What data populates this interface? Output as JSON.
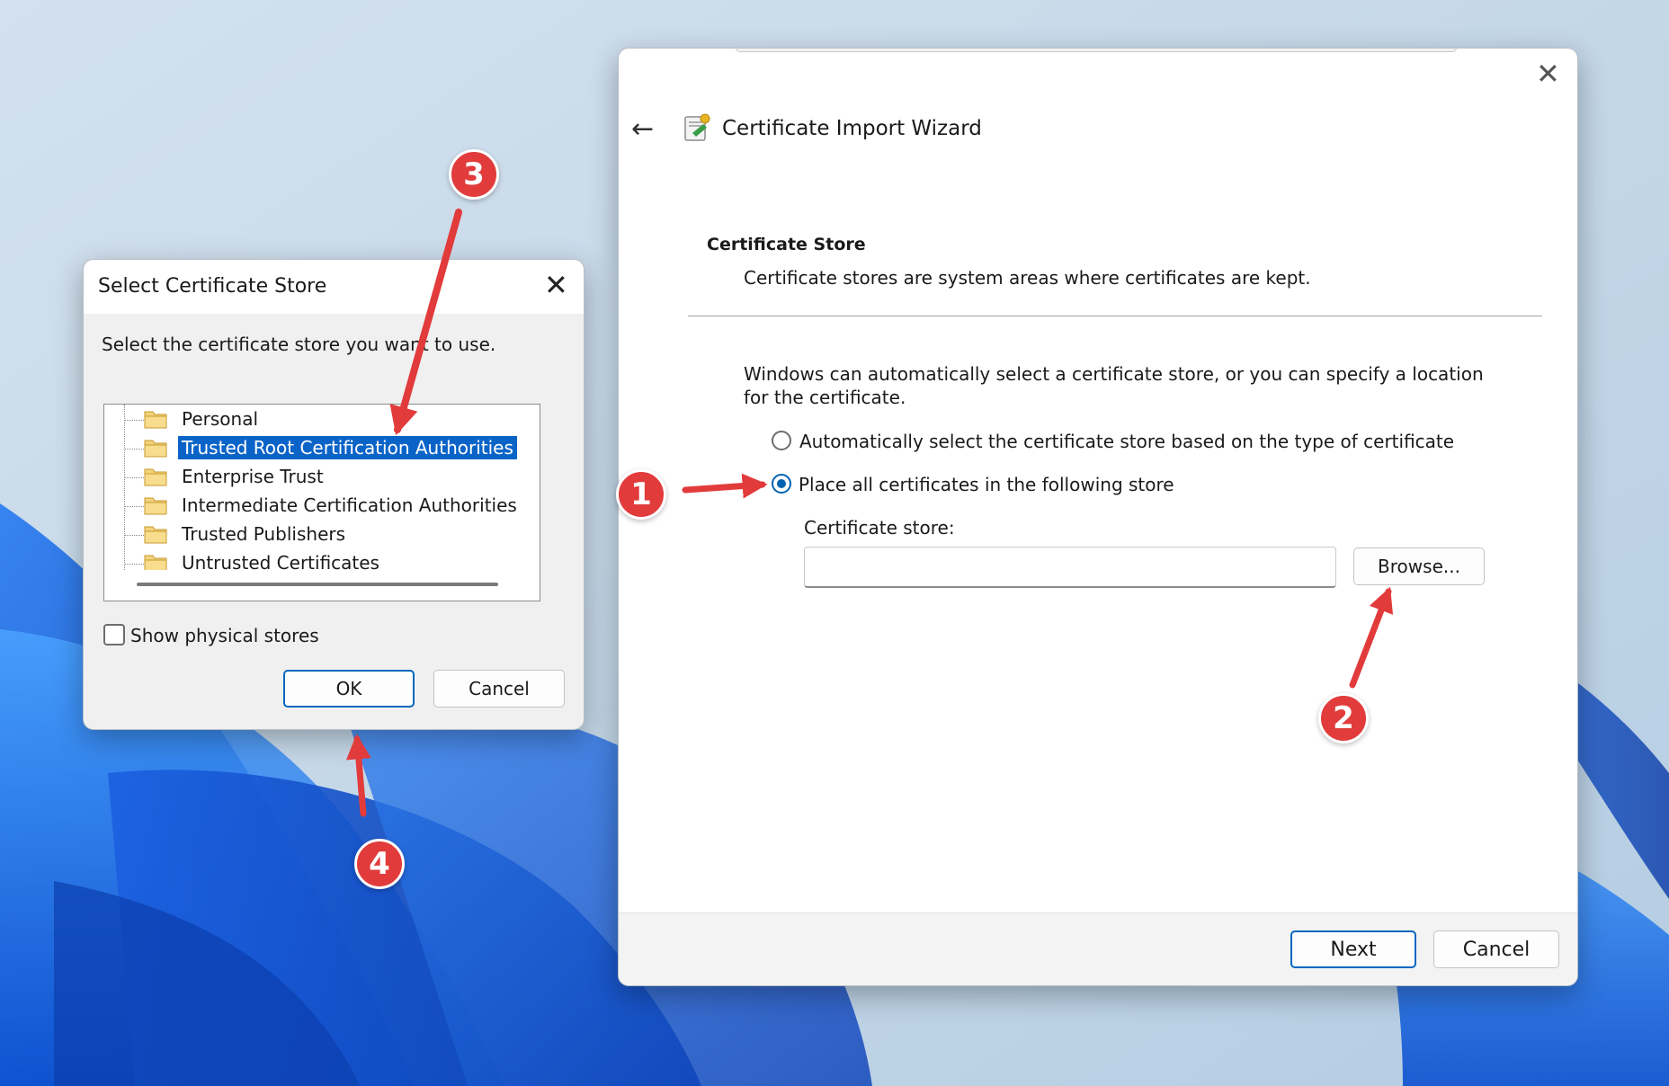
{
  "wizard": {
    "title": "Certificate Import Wizard",
    "close_glyph": "✕",
    "back_glyph": "←",
    "section_title": "Certificate Store",
    "section_subtitle": "Certificate stores are system areas where certificates are kept.",
    "description": "Windows can automatically select a certificate store, or you can specify a location for the certificate.",
    "radio_auto_label": "Automatically select the certificate store based on the type of certificate",
    "radio_manual_label": "Place all certificates in the following store",
    "store_field_label": "Certificate store:",
    "store_field_value": "",
    "browse_label": "Browse...",
    "next_label": "Next",
    "cancel_label": "Cancel",
    "selected_option": "manual"
  },
  "store_dialog": {
    "title": "Select Certificate Store",
    "close_glyph": "✕",
    "instruction": "Select the certificate store you want to use.",
    "items": [
      {
        "label": "Personal",
        "selected": false
      },
      {
        "label": "Trusted Root Certification Authorities",
        "selected": true
      },
      {
        "label": "Enterprise Trust",
        "selected": false
      },
      {
        "label": "Intermediate Certification Authorities",
        "selected": false
      },
      {
        "label": "Trusted Publishers",
        "selected": false
      },
      {
        "label": "Untrusted Certificates",
        "selected": false
      }
    ],
    "show_physical_label": "Show physical stores",
    "show_physical_checked": false,
    "ok_label": "OK",
    "cancel_label": "Cancel"
  },
  "annotations": {
    "badges": [
      "1",
      "2",
      "3",
      "4"
    ],
    "color": "#e23b3b"
  },
  "colors": {
    "accent": "#0067c0",
    "selection": "#0a64c8",
    "annotation": "#e23b3b"
  }
}
